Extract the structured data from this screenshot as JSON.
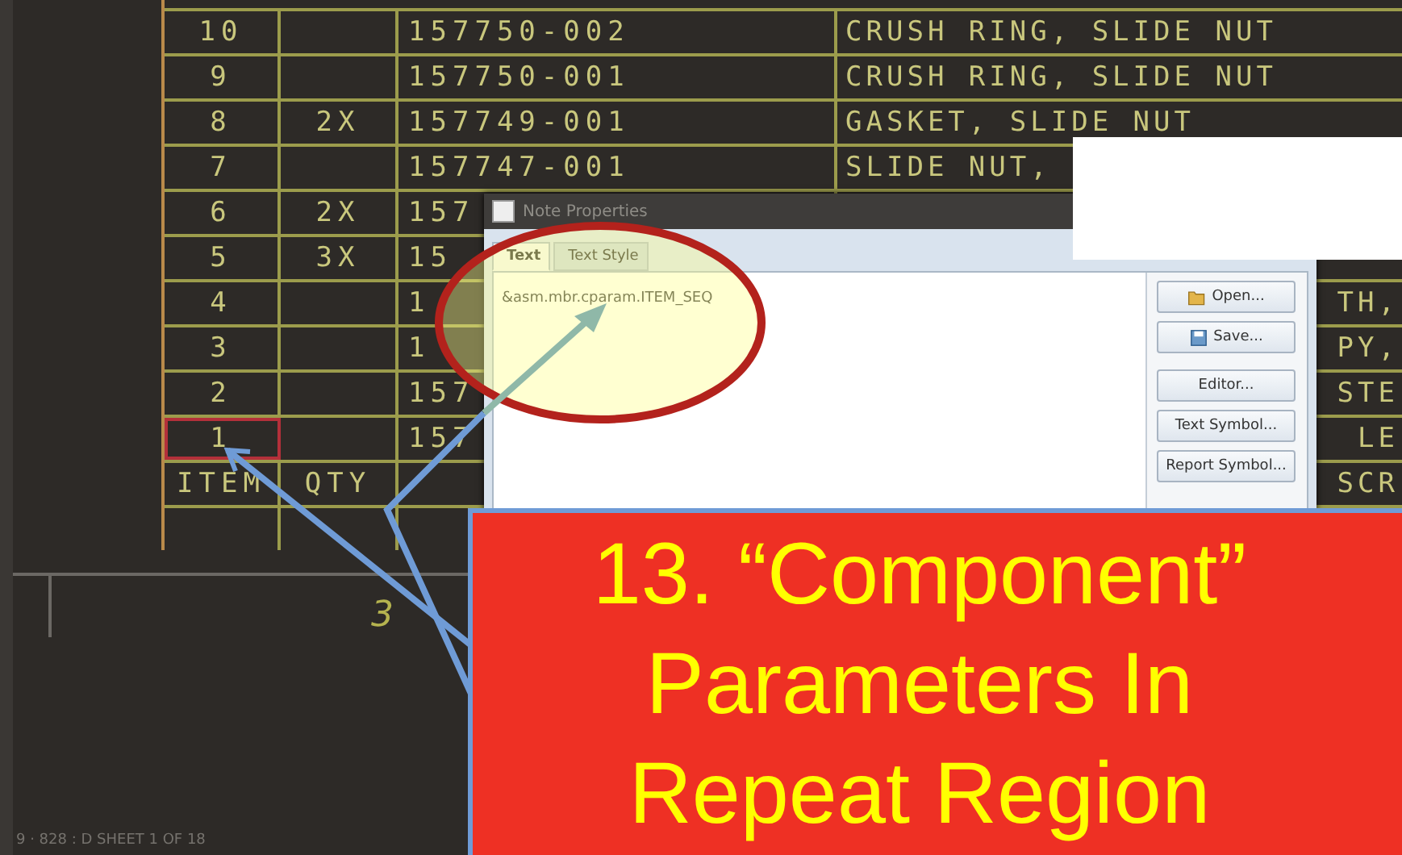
{
  "bom_table": {
    "rows": [
      {
        "item": "10",
        "qty": "",
        "part": "157750-002",
        "description": "CRUSH RING, SLIDE NUT",
        "description_end": "",
        "selected": false
      },
      {
        "item": "9",
        "qty": "",
        "part": "157750-001",
        "description": "CRUSH RING, SLIDE NUT",
        "description_end": "",
        "selected": false
      },
      {
        "item": "8",
        "qty": "2X",
        "part": "157749-001",
        "description": "GASKET, SLIDE NUT",
        "description_end": "",
        "selected": false
      },
      {
        "item": "7",
        "qty": "",
        "part": "157747-001",
        "description": "SLIDE NUT,",
        "description_end": "",
        "selected": false
      },
      {
        "item": "6",
        "qty": "2X",
        "part": "157",
        "description": "",
        "description_end": "",
        "selected": false
      },
      {
        "item": "5",
        "qty": "3X",
        "part": "15",
        "description": "",
        "description_end": "",
        "selected": false
      },
      {
        "item": "4",
        "qty": "",
        "part": "1",
        "description": "",
        "description_end": "TH,",
        "selected": false
      },
      {
        "item": "3",
        "qty": "",
        "part": "1",
        "description": "",
        "description_end": "PY,",
        "selected": false
      },
      {
        "item": "2",
        "qty": "",
        "part": "157",
        "description": "",
        "description_end": "STE",
        "selected": false
      },
      {
        "item": "1",
        "qty": "",
        "part": "157",
        "description": "",
        "description_end": "LE",
        "selected": true
      }
    ],
    "header": {
      "item": "ITEM",
      "qty": "QTY",
      "description_end": "SCR"
    }
  },
  "sheet_number": "3",
  "status_bar": "9 · 828 : D   SHEET 1 OF 18",
  "dialog": {
    "title": "Note Properties",
    "tabs": [
      {
        "label": "Text",
        "selected": true
      },
      {
        "label": "Text Style",
        "selected": false
      }
    ],
    "note_text": "&asm.mbr.cparam.ITEM_SEQ",
    "buttons": [
      {
        "label": "Open...",
        "kind": "open"
      },
      {
        "label": "Save...",
        "kind": "save"
      },
      {
        "label": "Editor...",
        "kind": "plain"
      },
      {
        "label": "Text Symbol...",
        "kind": "plain"
      },
      {
        "label": "Report Symbol...",
        "kind": "plain"
      }
    ]
  },
  "callout": {
    "lines": [
      "13. “Component”",
      "Parameters In",
      "Repeat Region"
    ]
  }
}
